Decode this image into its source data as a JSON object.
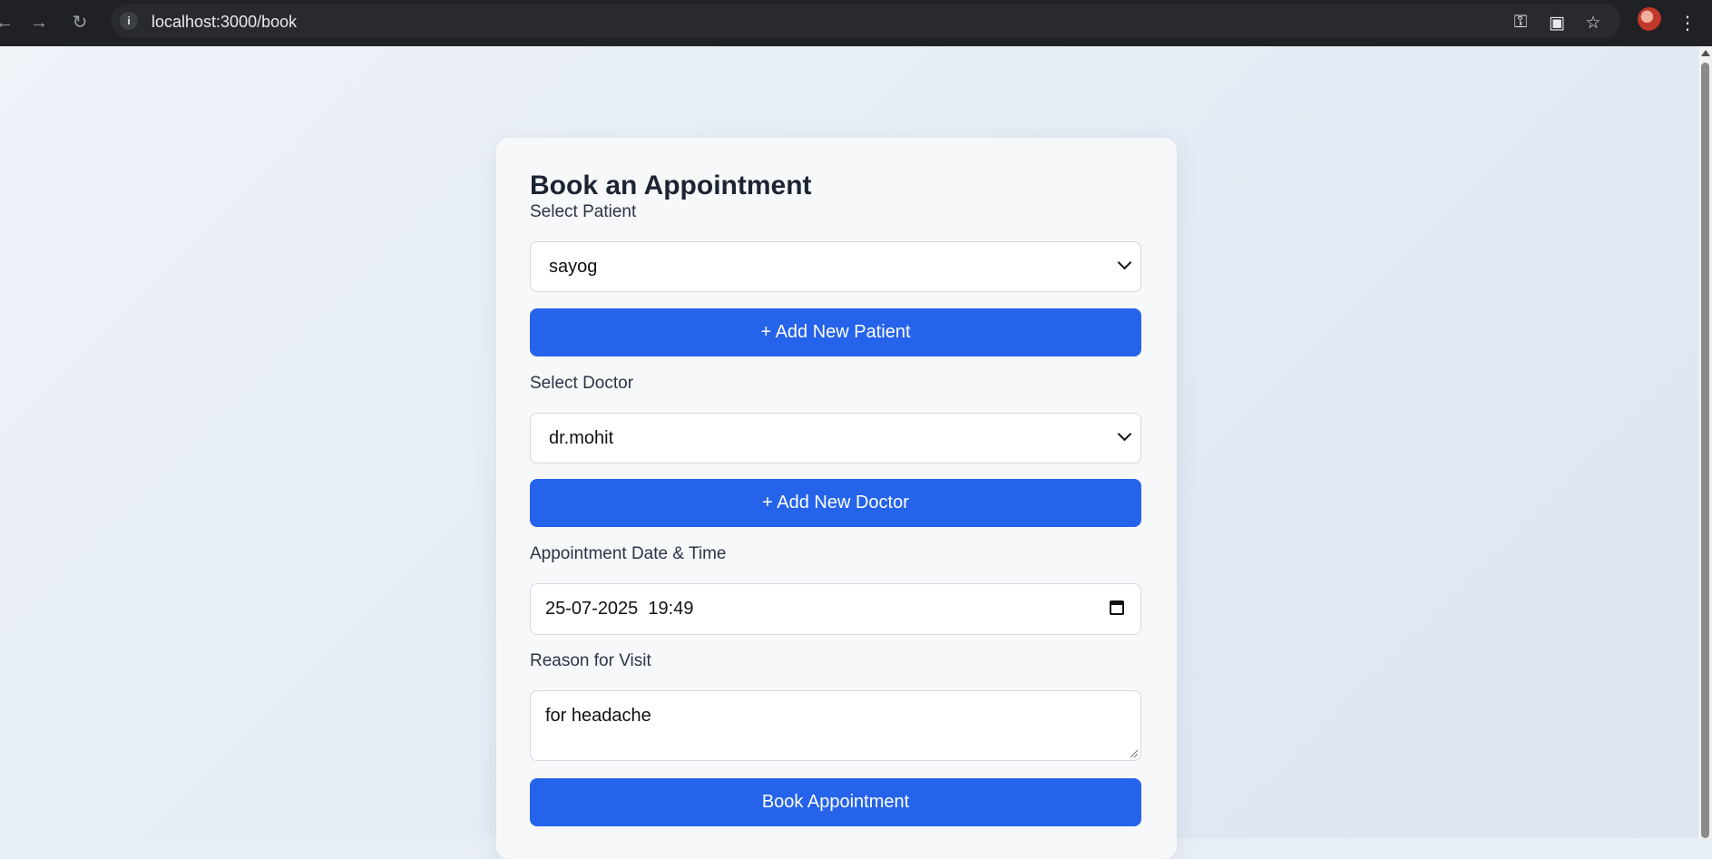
{
  "browser": {
    "url": "localhost:3000/book",
    "icons": [
      "back-icon",
      "forward-icon",
      "reload-icon",
      "info-icon",
      "password-key-icon",
      "install-app-icon",
      "bookmark-star-icon",
      "menu-kebab-icon"
    ]
  },
  "form": {
    "title": "Book an Appointment",
    "patient_label": "Select Patient",
    "patient_value": "sayog",
    "add_patient_label": "+ Add New Patient",
    "doctor_label": "Select Doctor",
    "doctor_value": "dr.mohit",
    "add_doctor_label": "+ Add New Doctor",
    "datetime_label": "Appointment Date & Time",
    "datetime_value": "25-07-2025  19:49",
    "reason_label": "Reason for Visit",
    "reason_value": "for headache",
    "submit_label": "Book Appointment"
  },
  "colors": {
    "primary": "#2563eb",
    "chrome": "#202124",
    "card": "#f6f8fa",
    "text": "#1c2433"
  }
}
